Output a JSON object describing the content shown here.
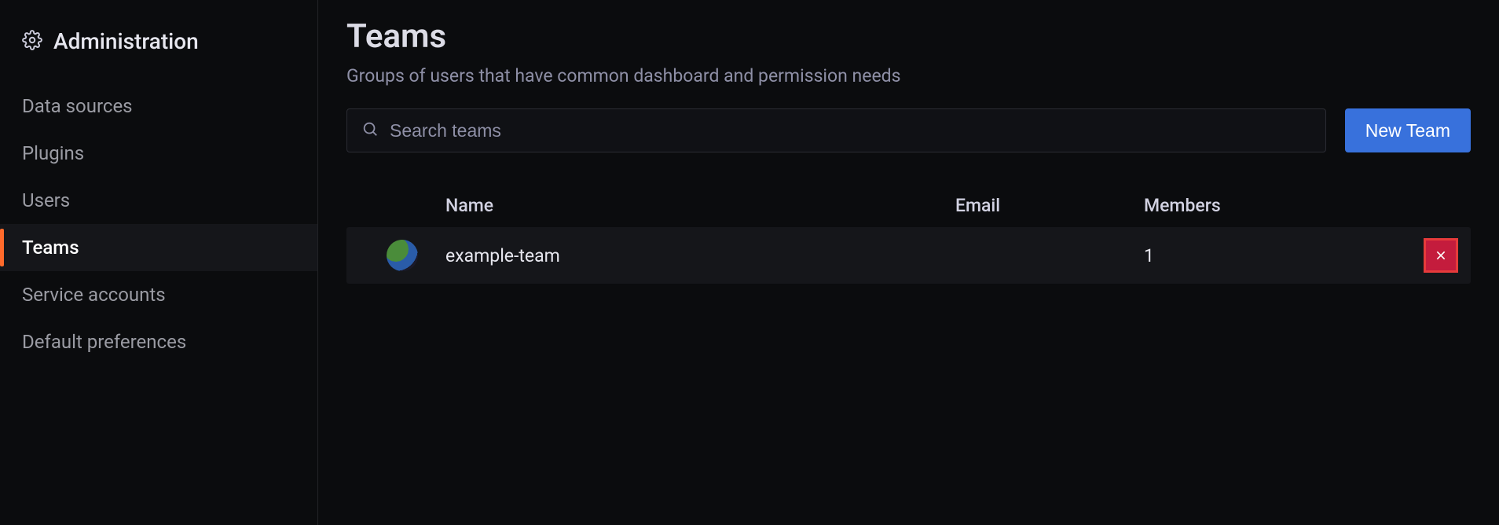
{
  "sidebar": {
    "title": "Administration",
    "items": [
      {
        "label": "Data sources",
        "active": false
      },
      {
        "label": "Plugins",
        "active": false
      },
      {
        "label": "Users",
        "active": false
      },
      {
        "label": "Teams",
        "active": true
      },
      {
        "label": "Service accounts",
        "active": false
      },
      {
        "label": "Default preferences",
        "active": false
      }
    ]
  },
  "page": {
    "title": "Teams",
    "subtitle": "Groups of users that have common dashboard and permission needs"
  },
  "search": {
    "placeholder": "Search teams"
  },
  "buttons": {
    "new_team": "New Team"
  },
  "table": {
    "headers": {
      "name": "Name",
      "email": "Email",
      "members": "Members"
    },
    "rows": [
      {
        "name": "example-team",
        "email": "",
        "members": "1"
      }
    ]
  }
}
